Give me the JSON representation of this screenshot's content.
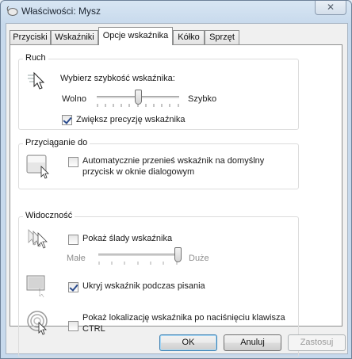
{
  "window": {
    "title": "Właściwości: Mysz",
    "close_glyph": "✕"
  },
  "tabs": [
    {
      "label": "Przyciski",
      "active": false
    },
    {
      "label": "Wskaźniki",
      "active": false
    },
    {
      "label": "Opcje wskaźnika",
      "active": true
    },
    {
      "label": "Kółko",
      "active": false
    },
    {
      "label": "Sprzęt",
      "active": false
    }
  ],
  "motion": {
    "group_label": "Ruch",
    "speed_label": "Wybierz szybkość wskaźnika:",
    "slow_label": "Wolno",
    "fast_label": "Szybko",
    "speed_level": 0.5,
    "precision_label": "Zwiększ precyzję wskaźnika",
    "precision_checked": true
  },
  "snap": {
    "group_label": "Przyciąganie do",
    "checkbox_label_line1": "Automatycznie przenieś wskaźnik na domyślny",
    "checkbox_label_line2": "przycisk w oknie dialogowym",
    "checked": false
  },
  "visibility": {
    "group_label": "Widoczność",
    "trails_label": "Pokaż ślady wskaźnika",
    "trails_checked": false,
    "short_label": "Małe",
    "long_label": "Duże",
    "trail_level": 1.0,
    "hide_label": "Ukryj wskaźnik podczas pisania",
    "hide_checked": true,
    "location_label_line1": "Pokaż lokalizację wskaźnika po naciśnięciu klawisza",
    "location_label_line2": "CTRL",
    "location_checked": false
  },
  "buttons": {
    "ok": "OK",
    "cancel": "Anuluj",
    "apply": "Zastosuj"
  },
  "icons": {
    "app": "mouse-icon",
    "motion": "pointer-motion-icon",
    "snap": "snap-to-icon",
    "trails": "pointer-trails-icon",
    "hide": "hide-pointer-icon",
    "location": "pointer-location-icon"
  },
  "colors": {
    "title_bar": "#c7d9ec",
    "default_button_border": "#3c7fb1"
  }
}
